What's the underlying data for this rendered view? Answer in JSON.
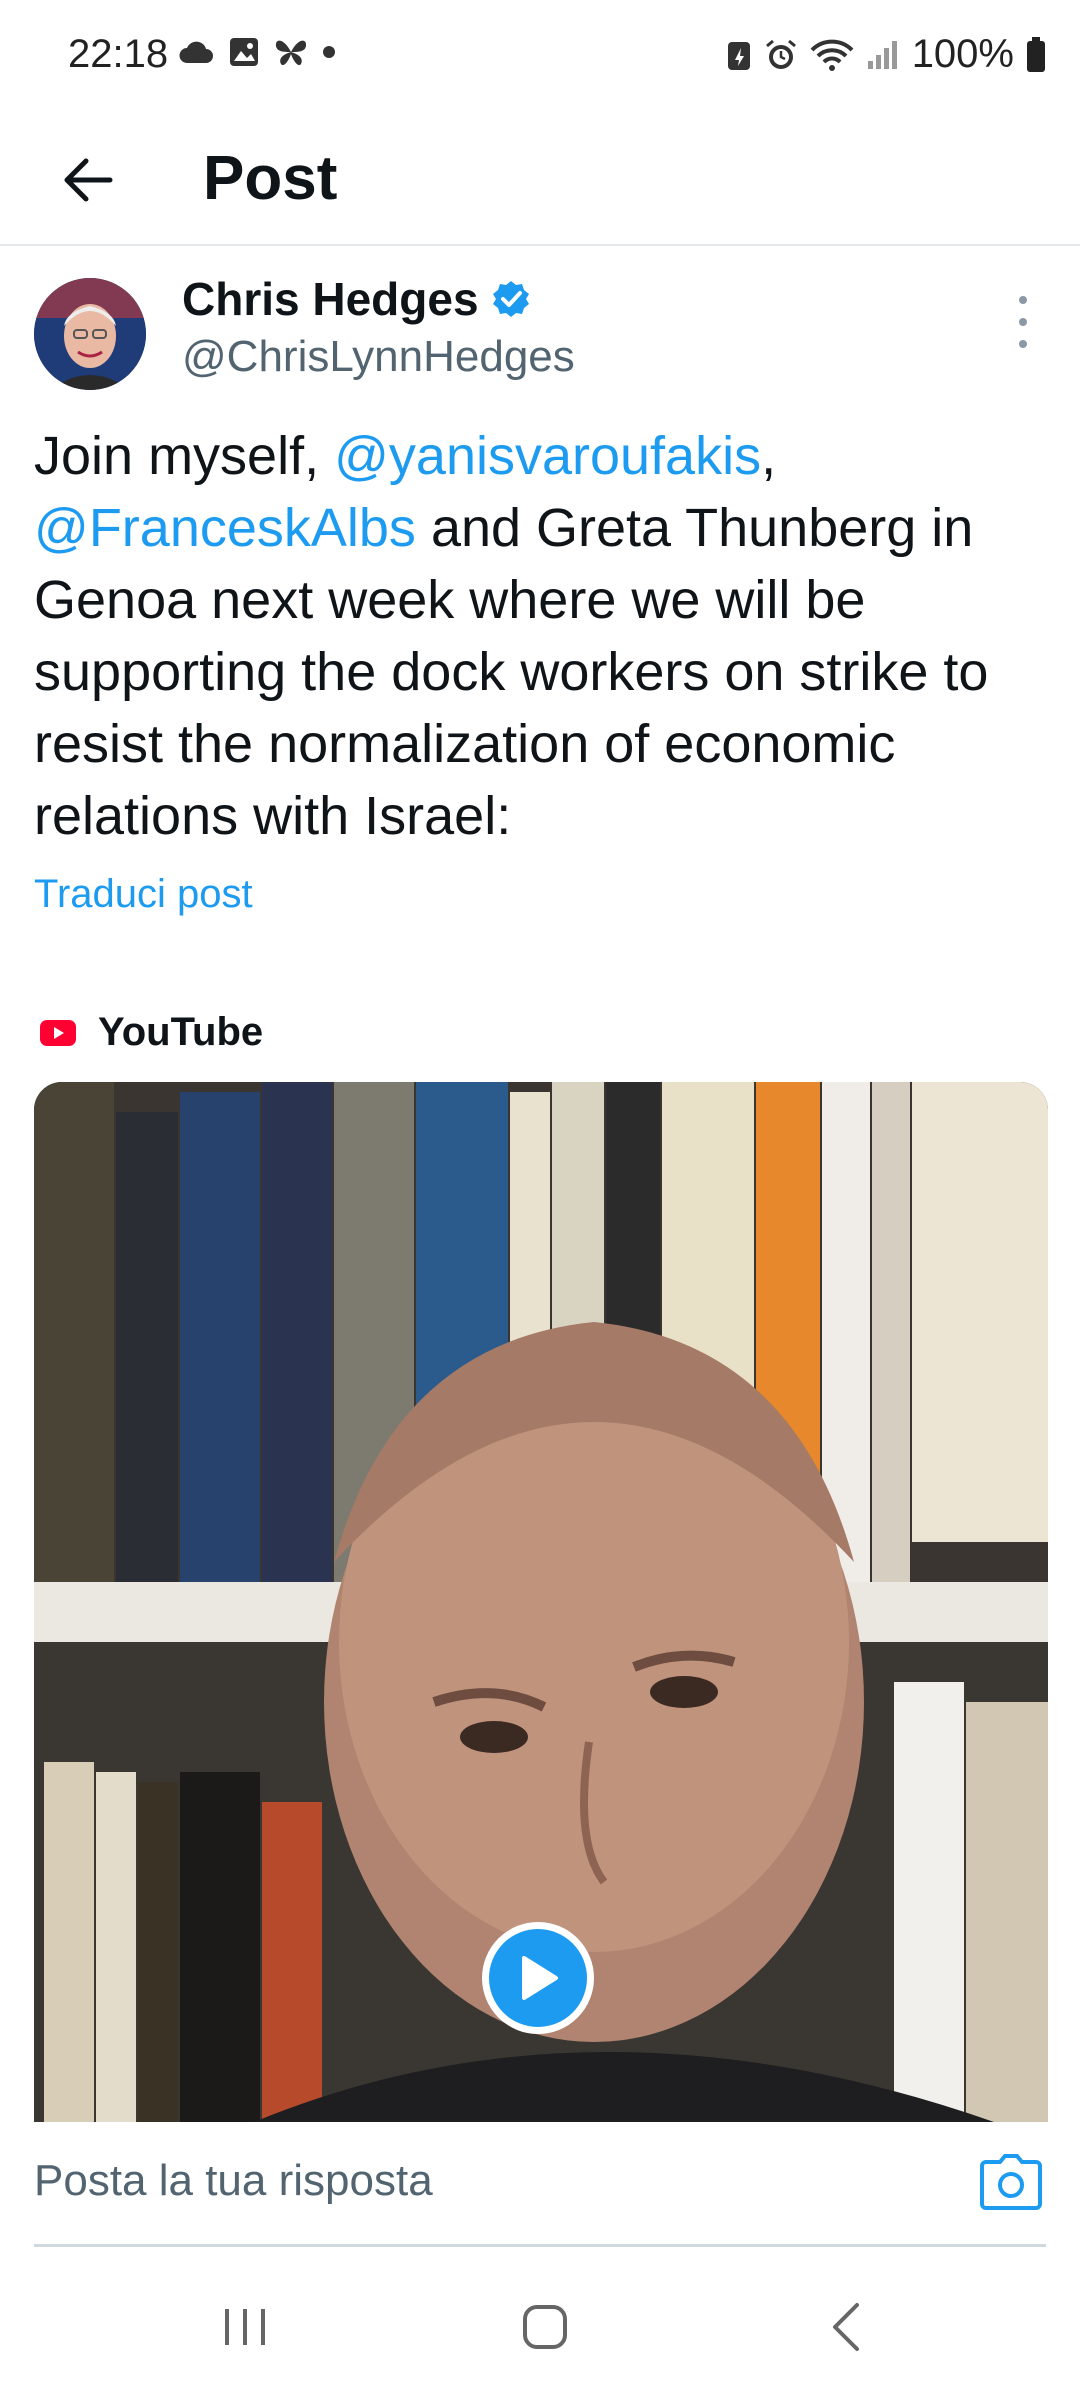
{
  "status_bar": {
    "time": "22:18",
    "left_icons": [
      "cloud-icon",
      "image-icon",
      "butterfly-icon",
      "dot-icon"
    ],
    "right_icons": [
      "battery-saver-icon",
      "alarm-icon",
      "wifi-icon",
      "signal-icon",
      "battery-icon"
    ],
    "battery": "100%"
  },
  "header": {
    "back_icon": "arrow-left-icon",
    "title": "Post"
  },
  "post": {
    "author": {
      "name": "Chris Hedges",
      "handle": "@ChrisLynnHedges",
      "verified_icon": "verified-badge-icon"
    },
    "more_icon": "more-vertical-icon",
    "text_parts": {
      "p1": "Join myself, ",
      "m1": "@yanisvaroufakis",
      "p2": ", ",
      "m2": "@FranceskAlbs",
      "p3": " and Greta Thunberg in Genoa next week where we will be supporting the dock workers on strike to resist the normalization of economic relations with Israel:"
    },
    "translate_label": "Traduci post",
    "card": {
      "source_icon": "youtube-icon",
      "source": "YouTube",
      "play_icon": "play-icon"
    }
  },
  "reply": {
    "placeholder": "Posta la tua risposta",
    "camera_icon": "camera-icon"
  },
  "nav": {
    "icons": [
      "recent-apps-icon",
      "home-icon",
      "back-icon"
    ]
  },
  "colors": {
    "accent": "#1d9bf0",
    "text": "#0f1419",
    "secondary": "#536471",
    "youtube_red": "#ff0033"
  }
}
